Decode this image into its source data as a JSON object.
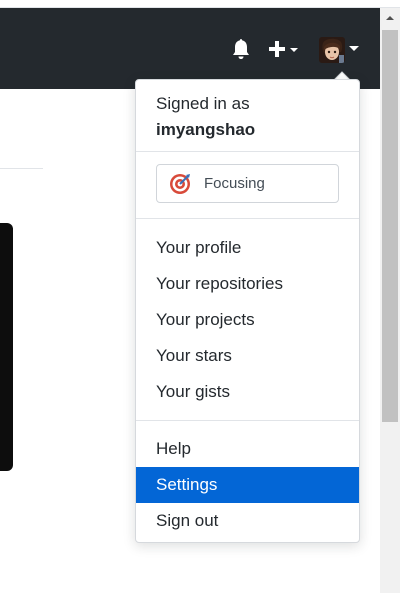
{
  "header": {
    "notifications_icon": "bell-icon",
    "create_icon": "plus-icon",
    "create_caret_icon": "caret-down-icon",
    "avatar_caret_icon": "caret-down-icon",
    "background_color": "#24292e"
  },
  "dropdown": {
    "signed_in_label": "Signed in as",
    "username": "imyangshao",
    "status": {
      "icon": "target-emoji-icon",
      "label": "Focusing"
    },
    "profile_items": [
      {
        "label": "Your profile"
      },
      {
        "label": "Your repositories"
      },
      {
        "label": "Your projects"
      },
      {
        "label": "Your stars"
      },
      {
        "label": "Your gists"
      }
    ],
    "help_label": "Help",
    "settings_label": "Settings",
    "signout_label": "Sign out",
    "active_item": "Settings",
    "active_color": "#0366d6"
  }
}
